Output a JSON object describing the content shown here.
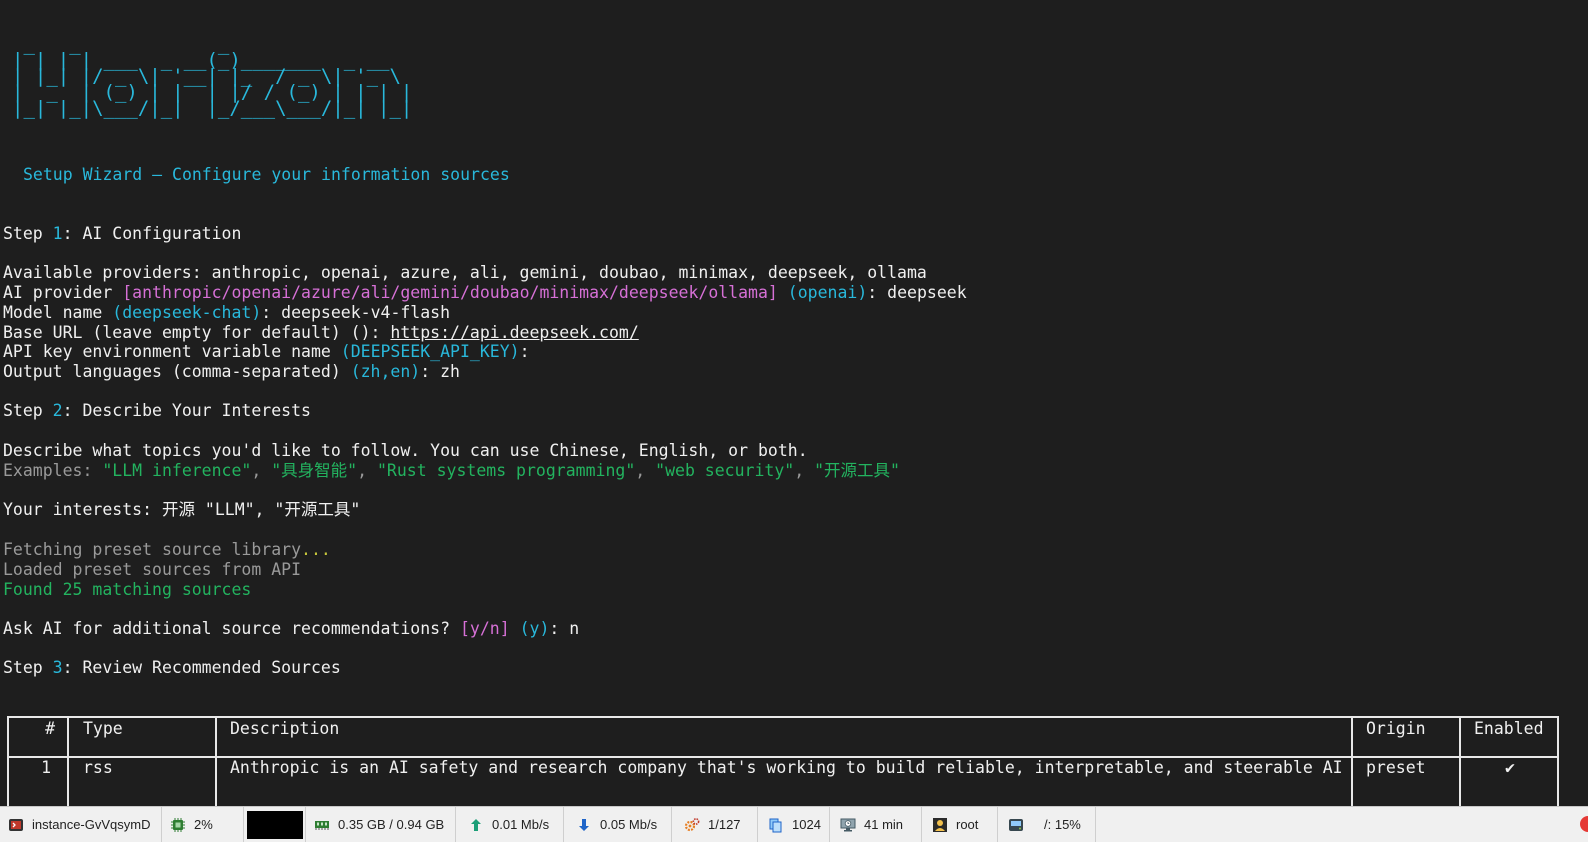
{
  "terminal": {
    "logo_lines": [
      " _   _            _",
      "| | | | ___  _ __(_)_______  _ __",
      "| |_| |/ _ \\| '__| |_  / _ \\| '_ \\",
      "|  _  | (_) | |  | |/ / (_) | | | |",
      "|_| |_|\\___/|_|  |_/___\\___/|_| |_|"
    ],
    "subtitle": "Setup Wizard — Configure your information sources",
    "step1": {
      "prefix": "Step ",
      "num": "1",
      "title": ": AI Configuration"
    },
    "providers_line": "Available providers: anthropic, openai, azure, ali, gemini, doubao, minimax, deepseek, ollama",
    "provider_prompt": {
      "label": "AI provider ",
      "options": "[anthropic/openai/azure/ali/gemini/doubao/minimax/deepseek/ollama]",
      "default": "(openai)",
      "suffix": ": ",
      "answer": "deepseek"
    },
    "model_prompt": {
      "label": "Model name ",
      "default": "(deepseek-chat)",
      "suffix": ": ",
      "answer": "deepseek-v4-flash"
    },
    "baseurl_prompt": {
      "label": "Base URL (leave empty for default) (): ",
      "answer": "https://api.deepseek.com/"
    },
    "apikey_prompt": {
      "label": "API key environment variable name ",
      "default": "(DEEPSEEK_API_KEY)",
      "suffix": ":"
    },
    "lang_prompt": {
      "label": "Output languages (comma-separated) ",
      "default": "(zh,en)",
      "suffix": ": ",
      "answer": "zh"
    },
    "step2": {
      "prefix": "Step ",
      "num": "2",
      "title": ": Describe Your Interests"
    },
    "describe_line": "Describe what topics you'd like to follow. You can use Chinese, English, or both.",
    "examples": {
      "label": "Examples: ",
      "items": [
        "\"LLM inference\"",
        "\"具身智能\"",
        "\"Rust systems programming\"",
        "\"web security\"",
        "\"开源工具\""
      ],
      "sep": ", "
    },
    "interests_prompt": {
      "label": "Your interests: ",
      "answer": "开源 \"LLM\", \"开源工具\""
    },
    "fetching": {
      "text": "Fetching preset source library",
      "dots": "..."
    },
    "loaded": "Loaded preset sources from API",
    "found": {
      "pre": "Found ",
      "num": "25",
      "post": " matching sources"
    },
    "ask_prompt": {
      "label": "Ask AI for additional source recommendations? ",
      "options": "[y/n]",
      "default": " (y)",
      "suffix": ": ",
      "answer": "n"
    },
    "step3": {
      "prefix": "Step ",
      "num": "3",
      "title": ": Review Recommended Sources"
    },
    "table": {
      "headers": [
        "#",
        "Type",
        "Description",
        "Origin",
        "Enabled"
      ],
      "rows": [
        {
          "num": "1",
          "type": "rss",
          "description": "Anthropic is an AI safety and research company that's working to build reliable, interpretable, and steerable AI",
          "origin": "preset",
          "enabled": "✔"
        }
      ]
    }
  },
  "statusbar": {
    "instance": "instance-GvVqsymD",
    "cpu": "2%",
    "memory": "0.35 GB / 0.94 GB",
    "upload": "0.01 Mb/s",
    "download": "0.05 Mb/s",
    "processes": "1/127",
    "files": "1024",
    "uptime": "41 min",
    "user": "root",
    "disk": "/: 15%"
  },
  "icons": {
    "instance": "terminal-app-icon",
    "cpu": "cpu-chip-icon",
    "memory": "memory-module-icon",
    "upload": "upload-arrow-icon",
    "download": "download-arrow-icon",
    "processes": "gears-icon",
    "files": "files-icon",
    "uptime": "monitor-clock-icon",
    "user": "user-icon",
    "disk": "disk-icon"
  },
  "colors": {
    "background": "#1e1e1e",
    "cyan": "#29b8db",
    "magenta": "#d670d6",
    "green": "#23b35f",
    "gray": "#9a9a9a",
    "statusbar": "#f0f0f0"
  }
}
